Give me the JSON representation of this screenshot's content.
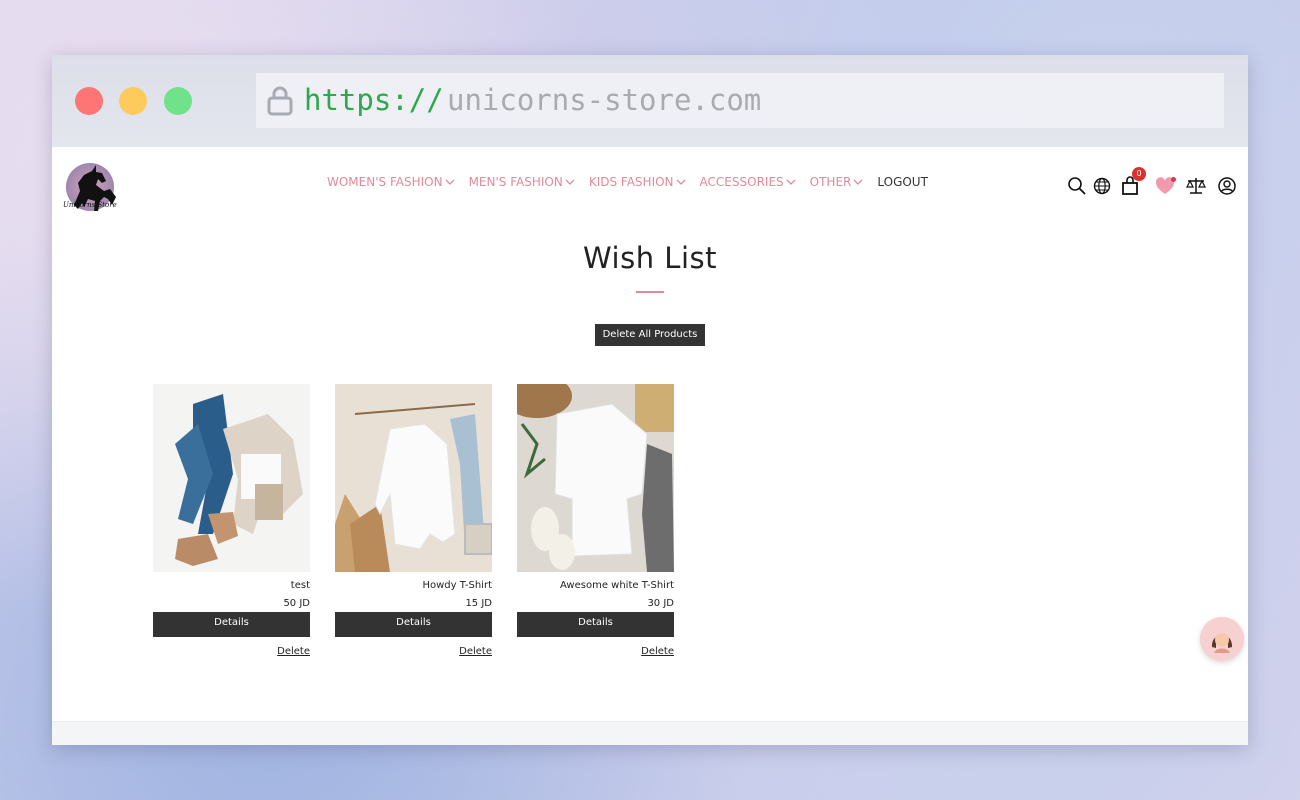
{
  "browser": {
    "url_protocol": "https://",
    "url_host": "unicorns-store.com"
  },
  "header": {
    "logo_text": "Unicorns Store",
    "nav": [
      {
        "label": "WOMEN'S FASHION"
      },
      {
        "label": "MEN'S FASHION"
      },
      {
        "label": "KIDS FASHION"
      },
      {
        "label": "ACCESSORIES"
      },
      {
        "label": "OTHER"
      }
    ],
    "logout_label": "LOGOUT",
    "cart_count": "0"
  },
  "main": {
    "title": "Wish List",
    "delete_all_label": "Delete All Products",
    "products": [
      {
        "name": "test",
        "price": "50 JD",
        "details_label": "Details",
        "delete_label": "Delete"
      },
      {
        "name": "Howdy T-Shirt",
        "price": "15 JD",
        "details_label": "Details",
        "delete_label": "Delete"
      },
      {
        "name": "Awesome white T-Shirt",
        "price": "30 JD",
        "details_label": "Details",
        "delete_label": "Delete"
      }
    ]
  },
  "colors": {
    "accent_pink": "#e18a9a",
    "button_dark": "#333333",
    "url_green": "#2ea84a"
  }
}
